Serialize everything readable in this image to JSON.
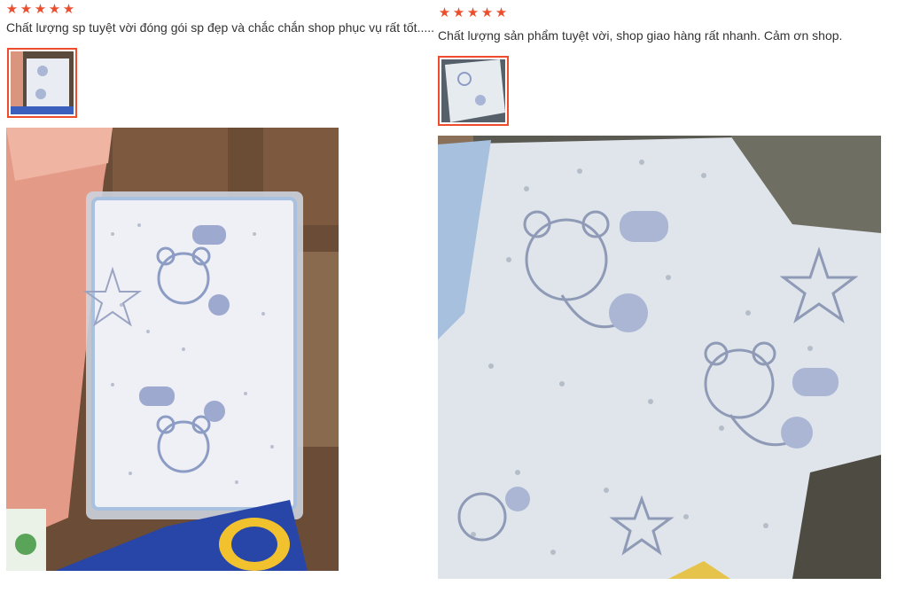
{
  "reviews": [
    {
      "rating": 5,
      "stars": [
        "★",
        "★",
        "★",
        "★",
        "★"
      ],
      "comment": "Chất lượng sp tuyệt vời đóng gói sp đẹp và chắc chắn shop phục vụ rất tốt.....",
      "thumbnail_icon": "photo-thumbnail",
      "photo_icon": "review-photo"
    },
    {
      "rating": 5,
      "stars": [
        "★",
        "★",
        "★",
        "★",
        "★"
      ],
      "comment": "Chất lượng sản phẩm tuyệt vời,  shop giao hàng rất nhanh.  Cảm ơn shop.",
      "thumbnail_icon": "photo-thumbnail",
      "photo_icon": "review-photo"
    }
  ],
  "colors": {
    "star": "#ee4d2d",
    "thumb_border": "#ee4d2d",
    "text": "#333333"
  }
}
